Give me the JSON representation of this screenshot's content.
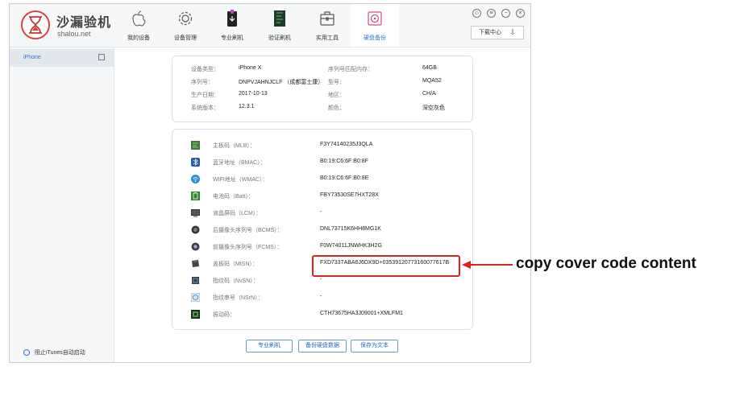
{
  "brand": {
    "name": "沙漏验机",
    "site": "shalou.net"
  },
  "nav": [
    {
      "label": "我的设备",
      "icon": "apple-icon"
    },
    {
      "label": "设备管理",
      "icon": "gear-icon"
    },
    {
      "label": "专业刷机",
      "icon": "phone-flash-icon"
    },
    {
      "label": "验证刷机",
      "icon": "circuit-board-icon"
    },
    {
      "label": "实用工具",
      "icon": "toolbox-icon"
    },
    {
      "label": "硬盘备份",
      "icon": "disk-backup-icon",
      "active": true
    }
  ],
  "window": {
    "download_center": "下载中心"
  },
  "sidebar": {
    "device": "iPhone",
    "itunes_toggle": "阻止iTunes自动启动"
  },
  "info": {
    "device_type_label": "设备类型：",
    "device_type": "iPhone X",
    "serial_label": "序列号：",
    "serial": "DNPVJAHNJCLF （成都富士康）",
    "mfg_date_label": "生产日期：",
    "mfg_date": "2017-10-13",
    "system_label": "系统版本：",
    "system": "12.3.1",
    "storage_label": "序列号匹配内存：",
    "storage": "64GB",
    "model_label": "型号：",
    "model": "MQA52",
    "region_label": "地区：",
    "region": "CH/A",
    "color_label": "颜色：",
    "color": "深空灰色"
  },
  "parts": [
    {
      "label": "主板码（MLB）：",
      "value": "F3Y74140235J3QLA",
      "icon": "mainboard-icon"
    },
    {
      "label": "蓝牙地址（BMAC）：",
      "value": "B0:19:C6:6F:B0:8F",
      "icon": "bluetooth-icon"
    },
    {
      "label": "WIFI地址（WMAC）：",
      "value": "B0:19:C6:6F:B0:8E",
      "icon": "wifi-icon"
    },
    {
      "label": "电池码（Batt）：",
      "value": "FBY73530SE7HXT28X",
      "icon": "battery-icon"
    },
    {
      "label": "液晶屏码（LCM）：",
      "value": "-",
      "icon": "lcd-screen-icon"
    },
    {
      "label": "后摄像头序列号（BCMS）：",
      "value": "DNL73715K6HH8MG1K",
      "icon": "rear-camera-icon"
    },
    {
      "label": "前摄像头序列号（FCMS）：",
      "value": "F0W74011JNWHK3H2G",
      "icon": "front-camera-icon"
    },
    {
      "label": "盖板码（MtSN）：",
      "value": "FXD7337ABA6J6DX9D+03539120773160077617B",
      "icon": "cover-panel-icon"
    },
    {
      "label": "指纹码（NvSN）：",
      "value": "-",
      "icon": "fingerprint-chip-icon"
    },
    {
      "label": "指纹串号（NSrN）：",
      "value": "-",
      "icon": "fingerprint-serial-icon"
    },
    {
      "label": "振动码：",
      "value": "CTH73675HA3J09001+XMLFM1",
      "icon": "vibration-motor-icon"
    }
  ],
  "buttons": {
    "flash": "专业刷机",
    "backup": "备份硬盘数据",
    "save": "保存为文本"
  },
  "annotation": {
    "text": "copy cover code content",
    "color": "#d9231c"
  },
  "colors": {
    "accent": "#2c78d4",
    "highlight": "#d9231c"
  }
}
